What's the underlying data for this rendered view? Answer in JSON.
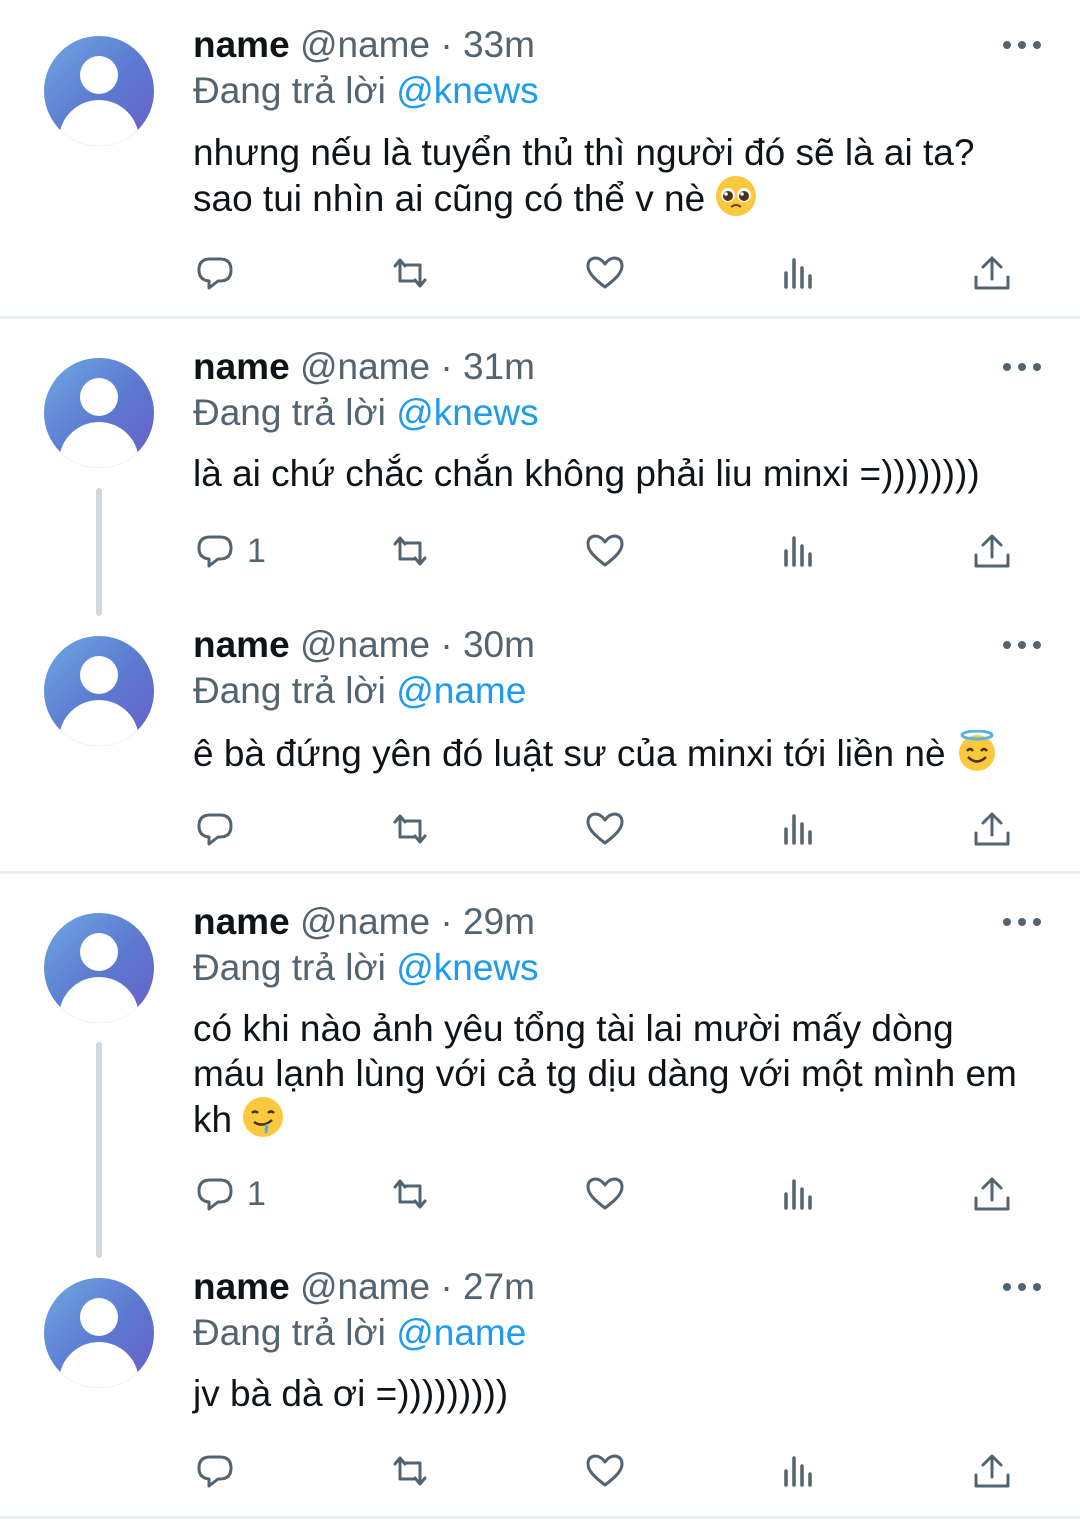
{
  "reply_prefix": "Đang trả lời",
  "tweets": [
    {
      "name": "name",
      "handle": "@name",
      "dot": "·",
      "time": "33m",
      "mention": "@knews",
      "text_lines": [
        "nhưng nếu là tuyển thủ thì người đó sẽ là ai ta?",
        "sao tui nhìn ai cũng có thể v nè"
      ],
      "emoji": "pleading-face",
      "reply_count": ""
    },
    {
      "name": "name",
      "handle": "@name",
      "dot": "·",
      "time": "31m",
      "mention": "@knews",
      "text_lines": [
        "là ai chứ chắc chắn không phải liu minxi =))))))))"
      ],
      "emoji": "",
      "reply_count": "1"
    },
    {
      "name": "name",
      "handle": "@name",
      "dot": "·",
      "time": "30m",
      "mention": "@name",
      "text_lines": [
        "ê bà đứng yên đó luật sư của minxi tới liền nè"
      ],
      "emoji": "smiling-face-with-halo",
      "reply_count": ""
    },
    {
      "name": "name",
      "handle": "@name",
      "dot": "·",
      "time": "29m",
      "mention": "@knews",
      "text_lines": [
        "có khi nào ảnh yêu tổng tài lai mười mấy dòng",
        "máu lạnh lùng với cả tg dịu dàng với một mình em",
        "kh"
      ],
      "emoji": "drooling-face",
      "reply_count": "1"
    },
    {
      "name": "name",
      "handle": "@name",
      "dot": "·",
      "time": "27m",
      "mention": "@name",
      "text_lines": [
        "jv bà dà ơi =)))))))))"
      ],
      "emoji": "",
      "reply_count": ""
    }
  ],
  "colors": {
    "text": "#0f1419",
    "secondary": "#536471",
    "accent": "#1d9bf0",
    "divider": "#e6ecf0",
    "thread_line": "#cfd9de"
  }
}
